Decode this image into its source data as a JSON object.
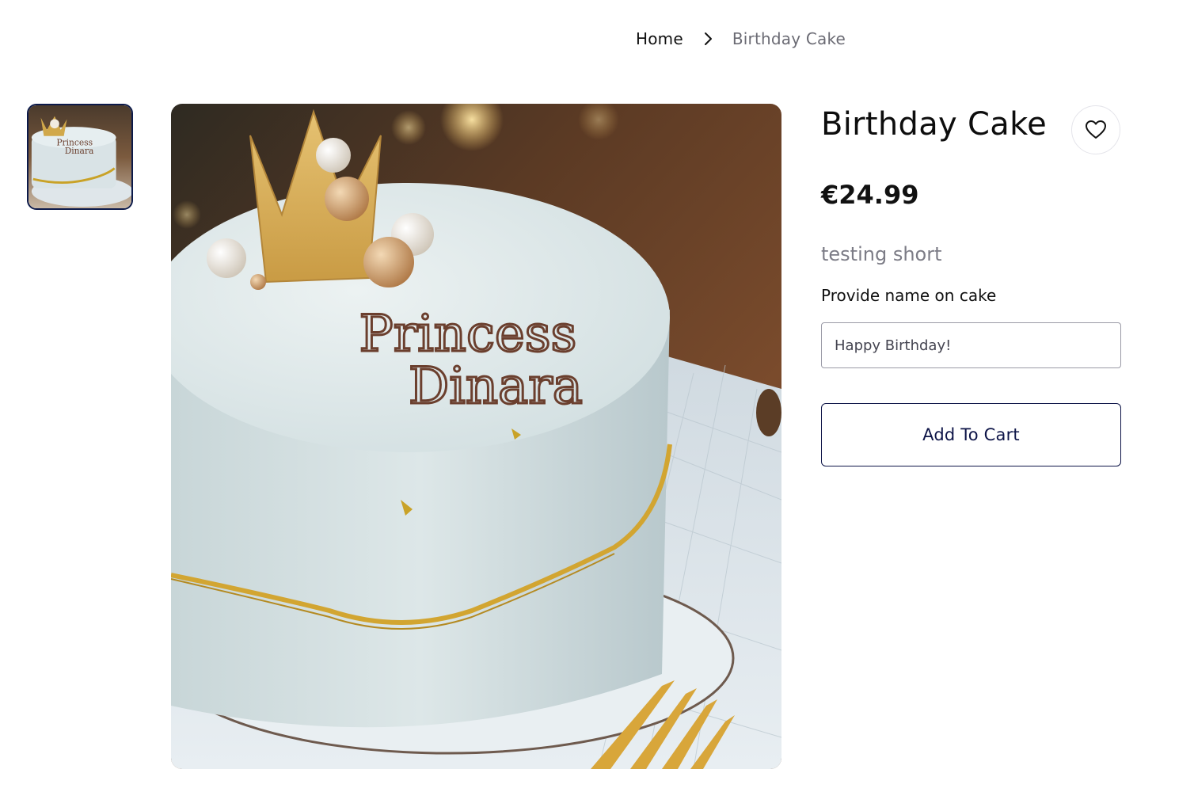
{
  "breadcrumb": {
    "home_label": "Home",
    "separator_icon": "chevron-right-icon",
    "current_label": "Birthday Cake"
  },
  "gallery": {
    "thumbnails": [
      {
        "alt": "Birthday Cake",
        "selected": true
      }
    ],
    "main_image_alt": "Birthday Cake",
    "cake_text_line1": "Princess",
    "cake_text_line2": "Dinara"
  },
  "product": {
    "title": "Birthday Cake",
    "wishlist_icon": "heart-icon",
    "price": "€24.99",
    "short_description": "testing short",
    "name_field_label": "Provide name on cake",
    "name_field_value": "Happy Birthday!",
    "add_to_cart_label": "Add To Cart"
  },
  "colors": {
    "accent": "#0d1447",
    "muted_text": "#7c7c86",
    "thumb_border": "#0c1a4a"
  }
}
